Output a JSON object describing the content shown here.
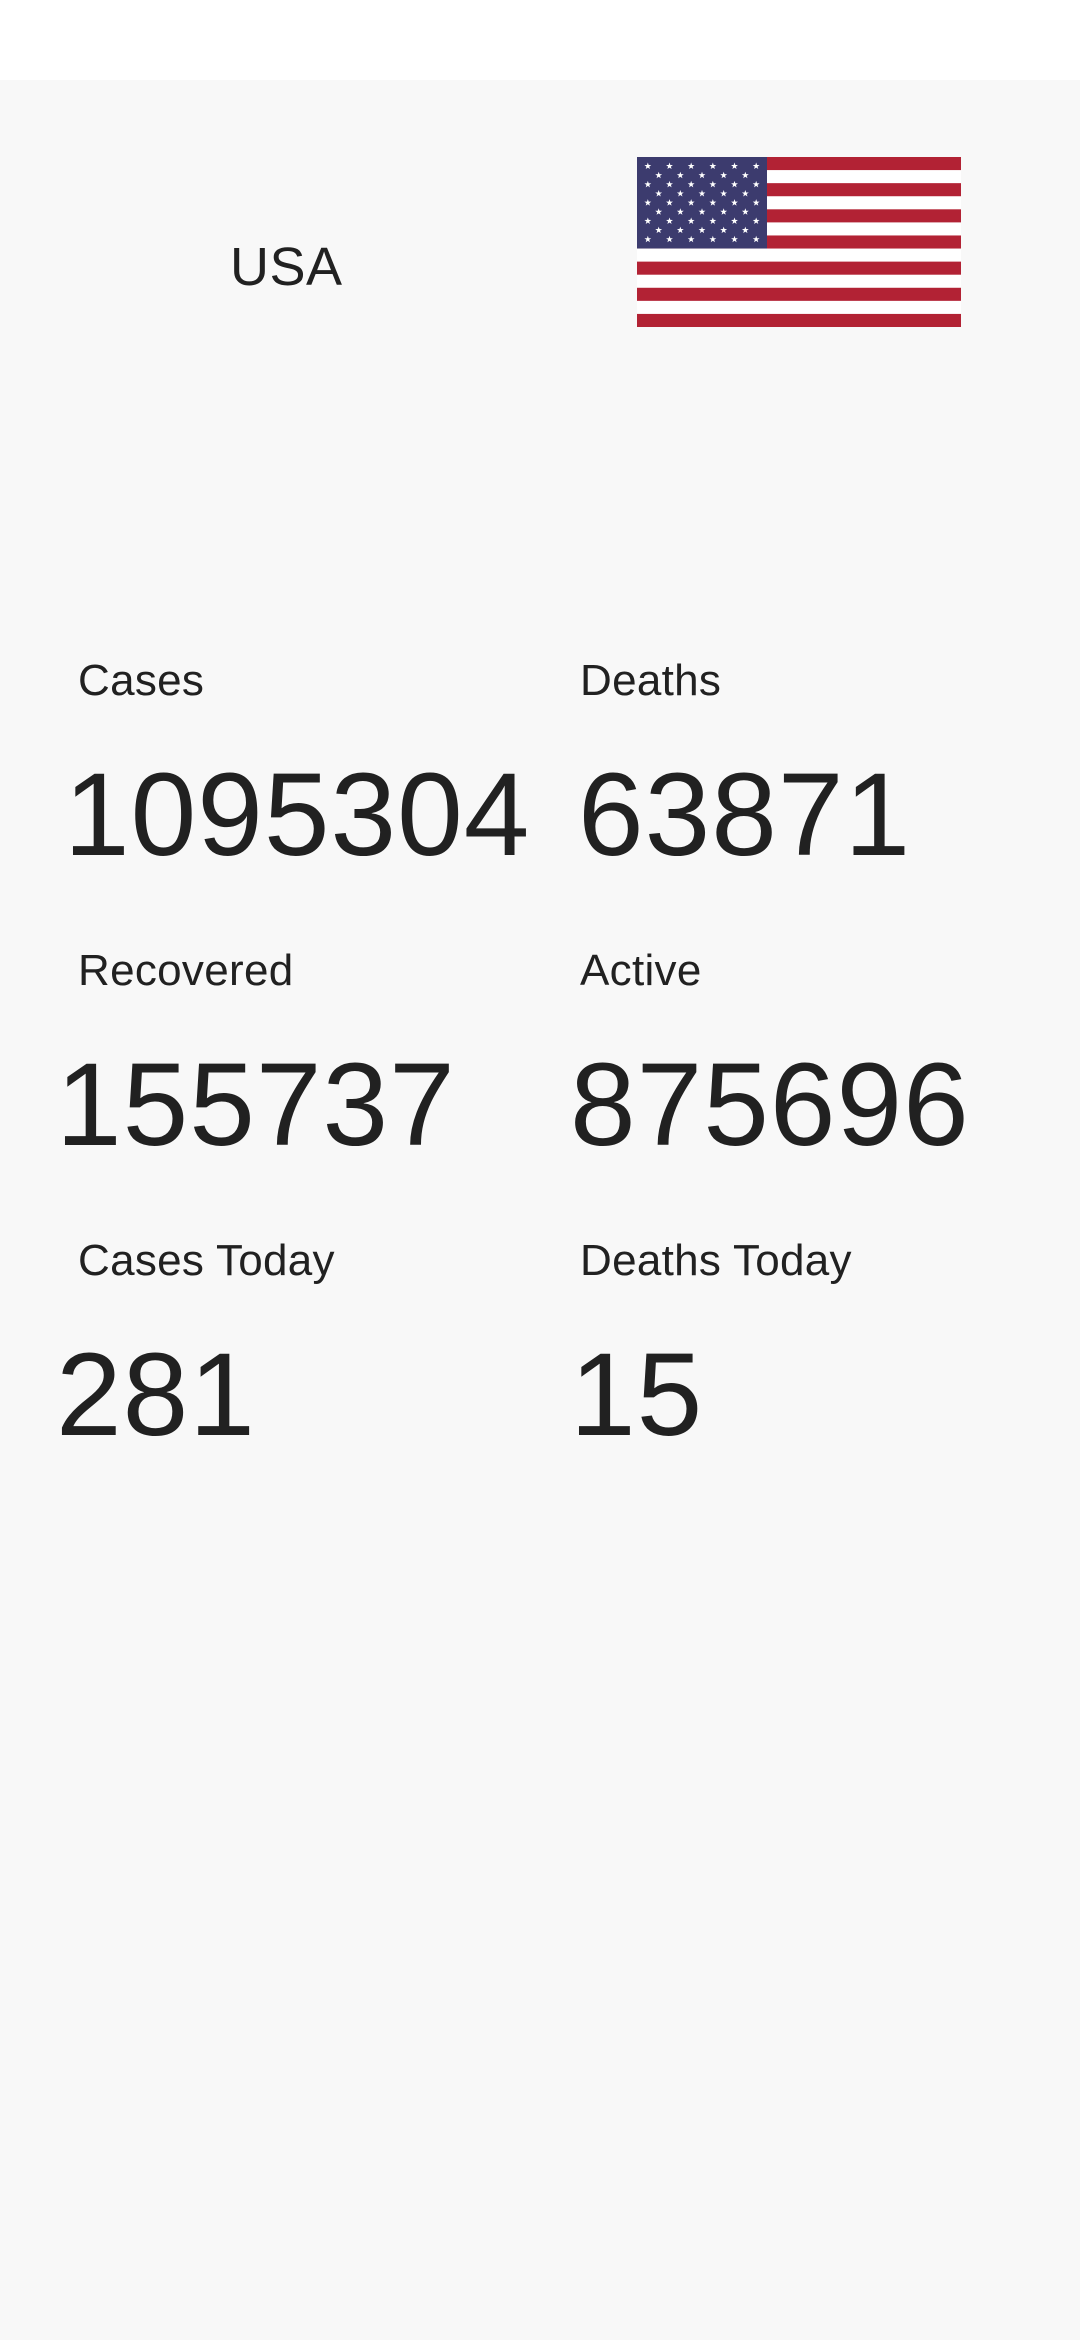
{
  "country": {
    "name": "USA",
    "flag_icon": "us-flag-icon",
    "flag_colors": {
      "red": "#b22234",
      "white": "#ffffff",
      "blue": "#3c3b6e"
    }
  },
  "stats": {
    "cases": {
      "label": "Cases",
      "value": "1095304"
    },
    "deaths": {
      "label": "Deaths",
      "value": "63871"
    },
    "recovered": {
      "label": "Recovered",
      "value": "155737"
    },
    "active": {
      "label": "Active",
      "value": "875696"
    },
    "cases_today": {
      "label": "Cases Today",
      "value": "281"
    },
    "deaths_today": {
      "label": "Deaths Today",
      "value": "15"
    }
  }
}
